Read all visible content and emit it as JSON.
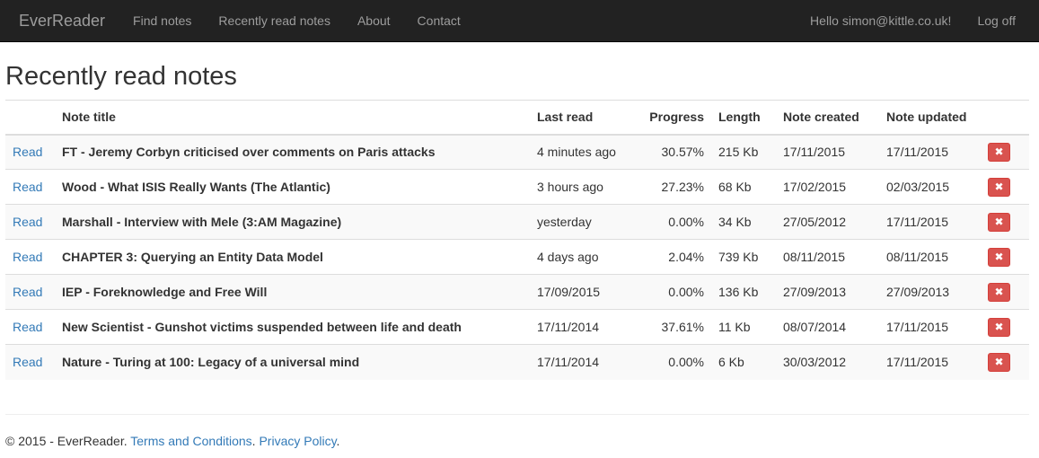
{
  "navbar": {
    "brand": "EverReader",
    "links": [
      "Find notes",
      "Recently read notes",
      "About",
      "Contact"
    ],
    "greeting": "Hello simon@kittle.co.uk!",
    "logoff": "Log off"
  },
  "page": {
    "title": "Recently read notes"
  },
  "table": {
    "headers": [
      "",
      "Note title",
      "Last read",
      "Progress",
      "Length",
      "Note created",
      "Note updated",
      ""
    ],
    "read_label": "Read",
    "delete_glyph": "✖",
    "rows": [
      {
        "title": "FT - Jeremy Corbyn criticised over comments on Paris attacks",
        "last_read": "4 minutes ago",
        "progress": "30.57%",
        "length": "215 Kb",
        "created": "17/11/2015",
        "updated": "17/11/2015"
      },
      {
        "title": "Wood - What ISIS Really Wants (The Atlantic)",
        "last_read": "3 hours ago",
        "progress": "27.23%",
        "length": "68 Kb",
        "created": "17/02/2015",
        "updated": "02/03/2015"
      },
      {
        "title": "Marshall - Interview with Mele (3:AM Magazine)",
        "last_read": "yesterday",
        "progress": "0.00%",
        "length": "34 Kb",
        "created": "27/05/2012",
        "updated": "17/11/2015"
      },
      {
        "title": "CHAPTER 3: Querying an Entity Data Model",
        "last_read": "4 days ago",
        "progress": "2.04%",
        "length": "739 Kb",
        "created": "08/11/2015",
        "updated": "08/11/2015"
      },
      {
        "title": "IEP - Foreknowledge and Free Will",
        "last_read": "17/09/2015",
        "progress": "0.00%",
        "length": "136 Kb",
        "created": "27/09/2013",
        "updated": "27/09/2013"
      },
      {
        "title": "New Scientist - Gunshot victims suspended between life and death",
        "last_read": "17/11/2014",
        "progress": "37.61%",
        "length": "11 Kb",
        "created": "08/07/2014",
        "updated": "17/11/2015"
      },
      {
        "title": "Nature - Turing at 100: Legacy of a universal mind",
        "last_read": "17/11/2014",
        "progress": "0.00%",
        "length": "6 Kb",
        "created": "30/03/2012",
        "updated": "17/11/2015"
      }
    ]
  },
  "footer": {
    "copyright": "© 2015 - EverReader.",
    "terms": "Terms and Conditions",
    "privacy": "Privacy Policy",
    "sep1": ".",
    "sep2": "."
  },
  "colors": {
    "navbar_bg": "#222222",
    "link": "#337ab7",
    "danger": "#d9534f",
    "stripe": "#f9f9f9"
  }
}
